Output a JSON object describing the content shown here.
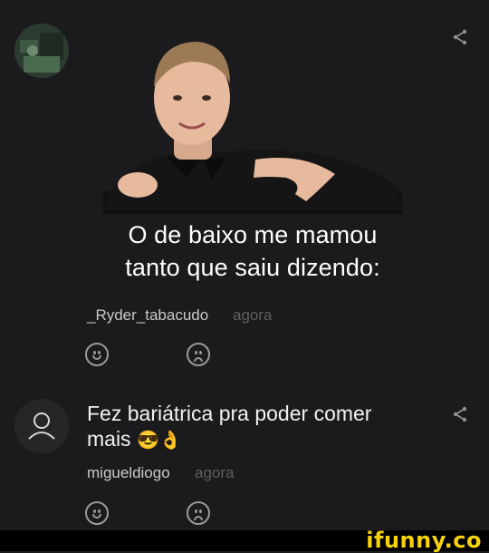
{
  "comments": [
    {
      "meme_text": [
        "O de baixo me mamou",
        "tanto que saiu dizendo:"
      ],
      "username": "_Ryder_tabacudo",
      "time": "agora"
    },
    {
      "text_line1": "Fez bariátrica pra poder comer",
      "text_line2": "mais",
      "emoji": "😎👌",
      "username": "migueldiogo",
      "time": "agora"
    }
  ],
  "watermark": "ifunny.co",
  "icons": {
    "share": "share-icon",
    "upvote": "smile-icon",
    "downvote": "sad-icon",
    "default_avatar": "user-icon"
  },
  "colors": {
    "background": "#1b1b1d",
    "watermark": "#f5d20a"
  }
}
